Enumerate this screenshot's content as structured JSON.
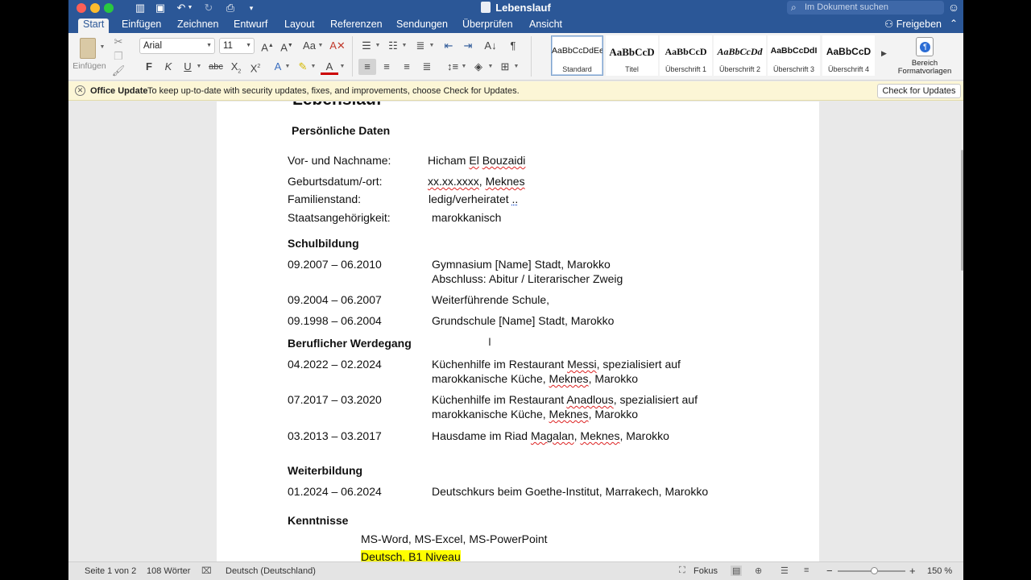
{
  "window": {
    "title": "Lebenslauf",
    "search_placeholder": "Im Dokument suchen",
    "share_label": "Freigeben"
  },
  "menu": {
    "tabs": [
      "Start",
      "Einfügen",
      "Zeichnen",
      "Entwurf",
      "Layout",
      "Referenzen",
      "Sendungen",
      "Überprüfen",
      "Ansicht"
    ],
    "active": "Start"
  },
  "ribbon": {
    "paste_label": "Einfügen",
    "font_name": "Arial",
    "font_size": "11",
    "styles": [
      {
        "preview": "AaBbCcDdEe",
        "name": "Standard"
      },
      {
        "preview": "AaBbCcD",
        "name": "Titel"
      },
      {
        "preview": "AaBbCcD",
        "name": "Überschrift 1"
      },
      {
        "preview": "AaBbCcDd",
        "name": "Überschrift 2"
      },
      {
        "preview": "AaBbCcDdI",
        "name": "Überschrift 3"
      },
      {
        "preview": "AaBbCcD",
        "name": "Überschrift 4"
      }
    ],
    "format_panel_label": "Bereich Formatvorlagen"
  },
  "update_bar": {
    "title": "Office Update",
    "message": "To keep up-to-date with security updates, fixes, and improvements, choose Check for Updates.",
    "button": "Check for Updates"
  },
  "document": {
    "heading_cut": "Lebenslauf",
    "personal": {
      "title": "Persönliche Daten",
      "name_label": "Vor- und Nachname:",
      "name_value_1": "Hicham ",
      "name_value_2": "El",
      "name_value_3": " ",
      "name_value_4": "Bouzaidi",
      "birth_label": "Geburtsdatum/-ort:",
      "birth_value_1": "xx.xx.xxxx",
      "birth_value_2": ", ",
      "birth_value_3": "Meknes",
      "family_label": "Familienstand:",
      "family_value": "ledig/verheiratet ",
      "family_suffix": "..",
      "nationality_label": "Staatsangehörigkeit:",
      "nationality_value": "marokkanisch"
    },
    "school": {
      "title": "Schulbildung",
      "entries": [
        {
          "date": "09.2007 – 06.2010",
          "line1": "Gymnasium  [Name] Stadt, Marokko",
          "line2": "Abschluss: Abitur / Literarischer Zweig"
        },
        {
          "date": "09.2004 – 06.2007",
          "line1": "Weiterführende Schule,"
        },
        {
          "date": "09.1998 – 06.2004",
          "line1": "Grundschule [Name] Stadt, Marokko"
        }
      ]
    },
    "career": {
      "title": "Beruflicher Werdegang",
      "e1_date": "04.2022 – 02.2024",
      "e1_a": "Küchenhilfe im Restaurant ",
      "e1_b": "Messi",
      "e1_c": ", spezialisiert auf",
      "e1_d": "marokkanische Küche, ",
      "e1_e": "Meknes",
      "e1_f": ", Marokko",
      "e2_date": "07.2017 – 03.2020",
      "e2_a": "Küchenhilfe im Restaurant ",
      "e2_b": "Anadlous",
      "e2_c": ", spezialisiert auf",
      "e2_d": "marokkanische Küche, ",
      "e2_e": "Meknes",
      "e2_f": ", Marokko",
      "e3_date": "03.2013 – 03.2017",
      "e3_a": "Hausdame im Riad ",
      "e3_b": "Magalan",
      "e3_c": ", ",
      "e3_d": "Meknes",
      "e3_e": ", Marokko"
    },
    "further": {
      "title": "Weiterbildung",
      "date": "01.2024 – 06.2024",
      "text": "Deutschkurs beim Goethe-Institut, Marrakech, Marokko"
    },
    "skills": {
      "title": "Kenntnisse",
      "line1": "MS-Word, MS-Excel, MS-PowerPoint",
      "line2": "Deutsch, B1 Niveau"
    }
  },
  "status": {
    "page": "Seite 1 von 2",
    "words": "108 Wörter",
    "language": "Deutsch (Deutschland)",
    "focus": "Fokus",
    "zoom": "150 %",
    "zoom_fraction": 0.55
  }
}
